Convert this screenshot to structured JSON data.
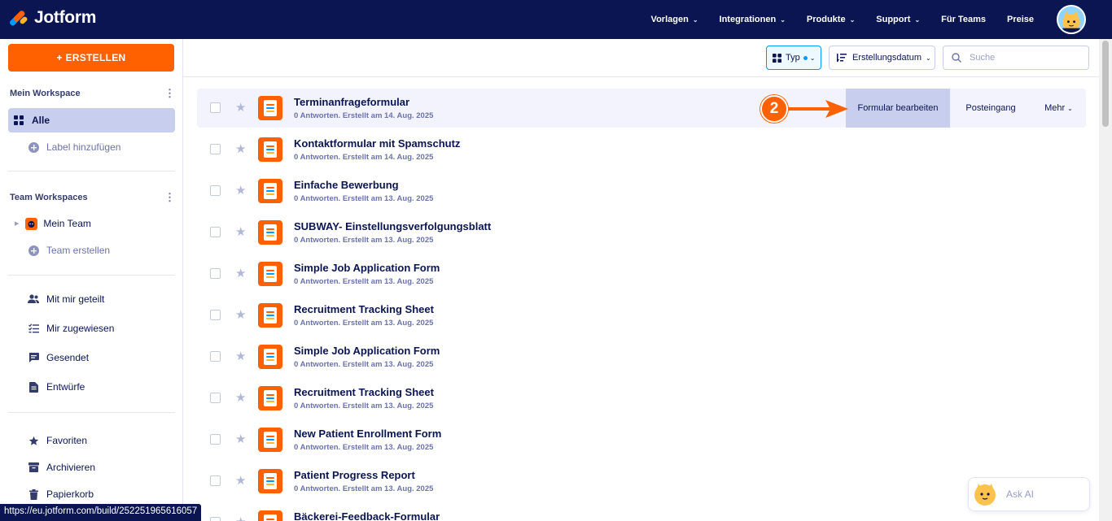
{
  "app": {
    "name": "Jotform"
  },
  "nav": {
    "items": [
      {
        "label": "Vorlagen",
        "dropdown": true
      },
      {
        "label": "Integrationen",
        "dropdown": true
      },
      {
        "label": "Produkte",
        "dropdown": true
      },
      {
        "label": "Support",
        "dropdown": true
      },
      {
        "label": "Für Teams",
        "dropdown": false
      },
      {
        "label": "Preise",
        "dropdown": false
      }
    ]
  },
  "sidebar": {
    "create_label": "+ ERSTELLEN",
    "my_workspace": {
      "heading": "Mein Workspace",
      "all_label": "Alle",
      "add_label": "Label hinzufügen"
    },
    "team_workspaces": {
      "heading": "Team Workspaces",
      "my_team": "Mein Team",
      "create_team": "Team erstellen"
    },
    "shared": [
      {
        "label": "Mit mir geteilt",
        "icon": "users-icon"
      },
      {
        "label": "Mir zugewiesen",
        "icon": "checklist-icon"
      },
      {
        "label": "Gesendet",
        "icon": "message-icon"
      },
      {
        "label": "Entwürfe",
        "icon": "draft-icon"
      }
    ],
    "bottom": [
      {
        "label": "Favoriten",
        "icon": "star-icon"
      },
      {
        "label": "Archivieren",
        "icon": "archive-icon"
      },
      {
        "label": "Papierkorb",
        "icon": "trash-icon"
      }
    ]
  },
  "toolbar": {
    "type_label": "Typ",
    "sort_label": "Erstellungsdatum",
    "search_placeholder": "Suche"
  },
  "row_actions": {
    "edit": "Formular bearbeiten",
    "inbox": "Posteingang",
    "more": "Mehr"
  },
  "annotation": {
    "step": "2",
    "color": "#ff6100"
  },
  "forms": [
    {
      "title": "Terminanfrageformular",
      "meta": "0 Antworten. Erstellt am 14. Aug. 2025"
    },
    {
      "title": "Kontaktformular mit Spamschutz",
      "meta": "0 Antworten. Erstellt am 14. Aug. 2025"
    },
    {
      "title": "Einfache Bewerbung",
      "meta": "0 Antworten. Erstellt am 13. Aug. 2025"
    },
    {
      "title": "SUBWAY- Einstellungsverfolgungsblatt",
      "meta": "0 Antworten. Erstellt am 13. Aug. 2025"
    },
    {
      "title": "Simple Job Application Form",
      "meta": "0 Antworten. Erstellt am 13. Aug. 2025"
    },
    {
      "title": "Recruitment Tracking Sheet",
      "meta": "0 Antworten. Erstellt am 13. Aug. 2025"
    },
    {
      "title": "Simple Job Application Form",
      "meta": "0 Antworten. Erstellt am 13. Aug. 2025"
    },
    {
      "title": "Recruitment Tracking Sheet",
      "meta": "0 Antworten. Erstellt am 13. Aug. 2025"
    },
    {
      "title": "New Patient Enrollment Form",
      "meta": "0 Antworten. Erstellt am 13. Aug. 2025"
    },
    {
      "title": "Patient Progress Report",
      "meta": "0 Antworten. Erstellt am 13. Aug. 2025"
    },
    {
      "title": "Bäckerei-Feedback-Formular",
      "meta": ""
    }
  ],
  "ask_ai": {
    "label": "Ask AI"
  },
  "status_bar": {
    "url": "https://eu.jotform.com/build/252251965616057"
  },
  "colors": {
    "navy": "#0a1551",
    "orange": "#ff6100",
    "active_bg": "#c8ceed",
    "hover_row": "#f3f3fe",
    "accent_blue": "#0099ff"
  }
}
